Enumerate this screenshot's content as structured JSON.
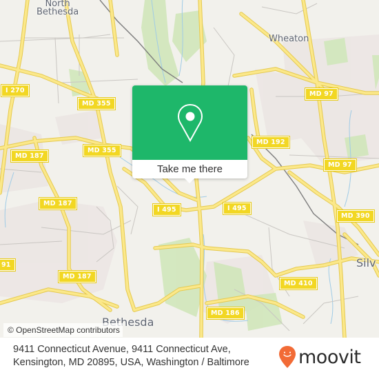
{
  "map": {
    "places": [
      {
        "name": "north-bethesda",
        "text": "North\nBethesda"
      },
      {
        "name": "wheaton",
        "text": "Wheaton"
      },
      {
        "name": "bethesda",
        "text": "Bethesda"
      },
      {
        "name": "silver-spring",
        "text": "Silv"
      }
    ],
    "shields": [
      {
        "name": "i270",
        "text": "I 270"
      },
      {
        "name": "md355-north",
        "text": "MD 355"
      },
      {
        "name": "md355-south",
        "text": "MD 355"
      },
      {
        "name": "md187-west",
        "text": "MD 187"
      },
      {
        "name": "md187-mid",
        "text": "MD 187"
      },
      {
        "name": "md187-south",
        "text": "MD 187"
      },
      {
        "name": "md97-north",
        "text": "MD 97"
      },
      {
        "name": "md192",
        "text": "MD 192"
      },
      {
        "name": "md97-east",
        "text": "MD 97"
      },
      {
        "name": "i495-west",
        "text": "I 495"
      },
      {
        "name": "i495-east",
        "text": "I 495"
      },
      {
        "name": "md390",
        "text": "MD 390"
      },
      {
        "name": "md410",
        "text": "MD 410"
      },
      {
        "name": "md186",
        "text": "MD 186"
      },
      {
        "name": "md191-partial",
        "text": "91"
      }
    ],
    "attribution": "© OpenStreetMap contributors"
  },
  "popup": {
    "icon": "map-pin-icon",
    "button_label": "Take me there"
  },
  "footer": {
    "address_line1": "9411 Connecticut Avenue, 9411 Connecticut Ave,",
    "address_line2": "Kensington, MD 20895, USA, Washington / Baltimore",
    "brand": "moovit",
    "brand_color": "#f26b36"
  },
  "colors": {
    "popup_green": "#1eb76a",
    "road_yellow": "#f7e26b",
    "shield_yellow": "#f2d723"
  }
}
